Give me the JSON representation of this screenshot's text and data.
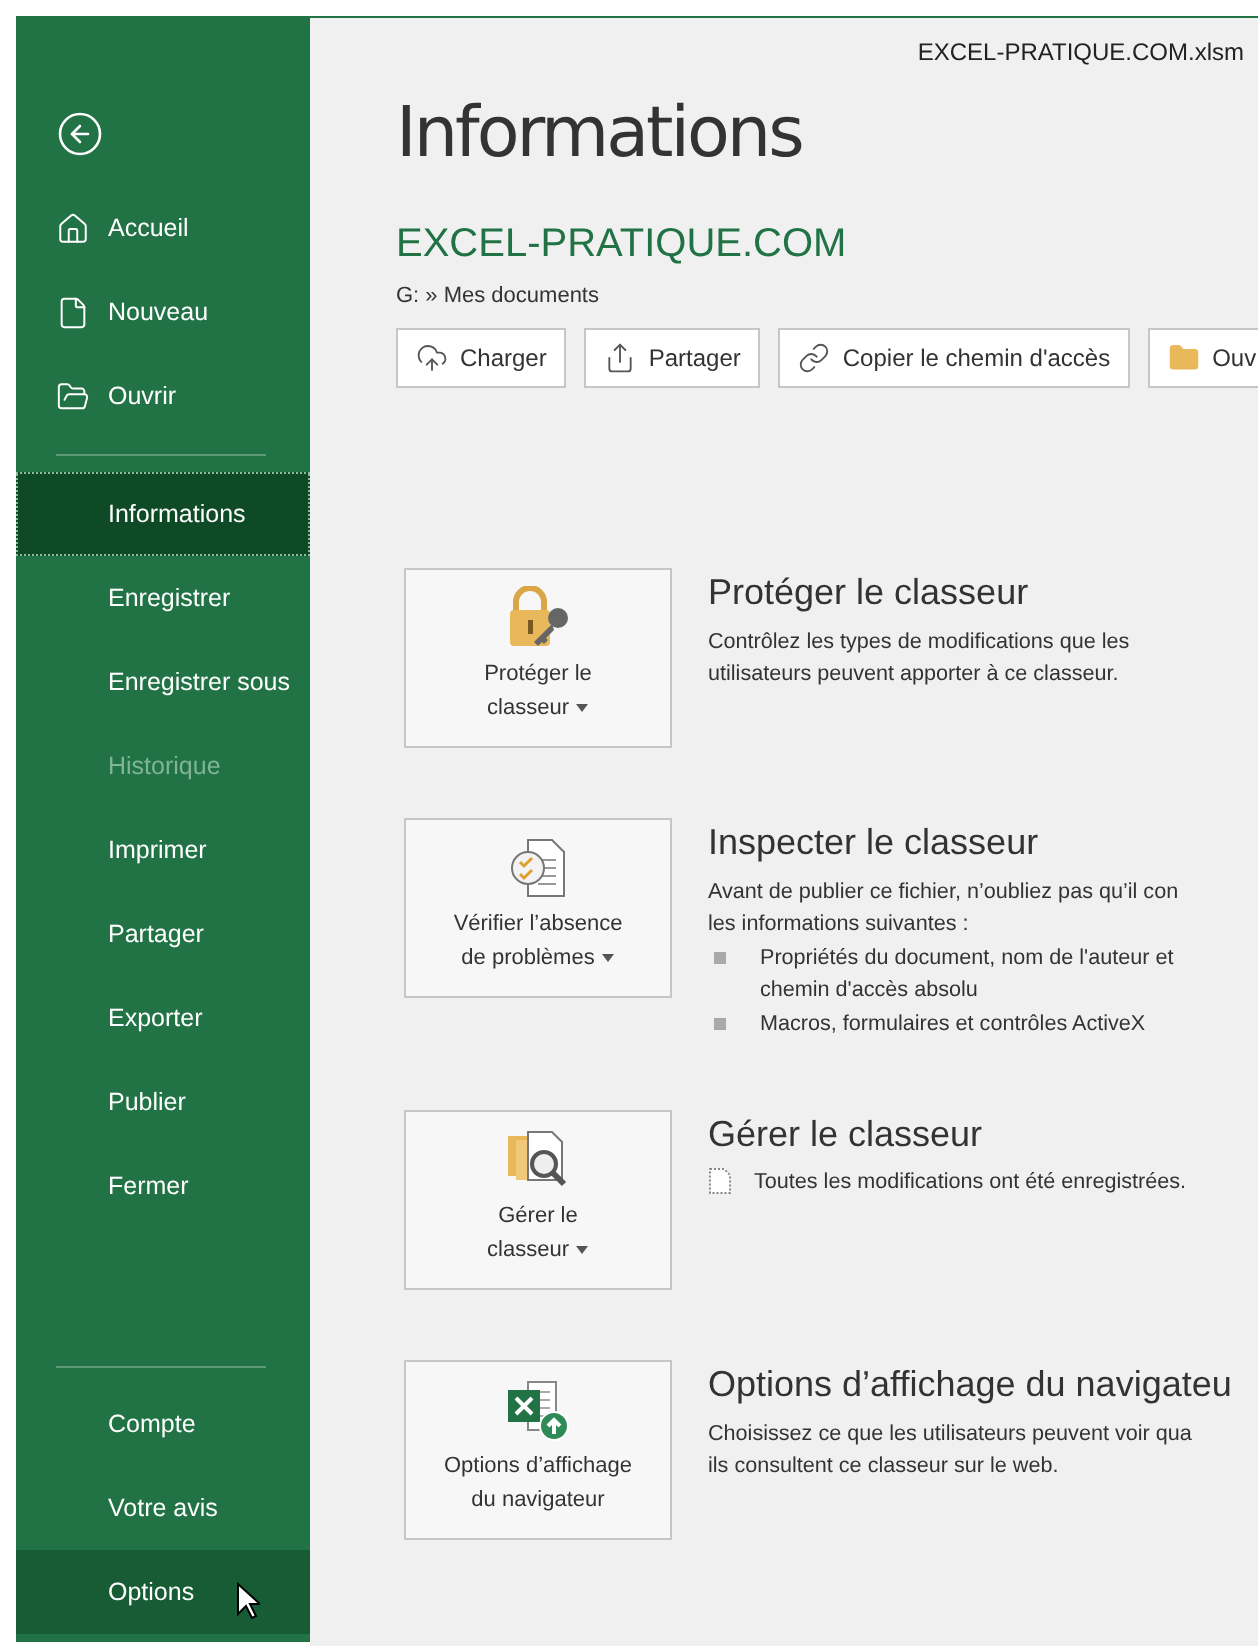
{
  "file_name": "EXCEL-PRATIQUE.COM.xlsm",
  "sidebar": {
    "top_items": [
      {
        "label": "Accueil",
        "kind": "home"
      },
      {
        "label": "Nouveau",
        "kind": "new"
      },
      {
        "label": "Ouvrir",
        "kind": "open"
      }
    ],
    "middle_items": [
      {
        "label": "Informations",
        "selected": true,
        "hovered": false,
        "disabled": false
      },
      {
        "label": "Enregistrer",
        "selected": false,
        "hovered": false,
        "disabled": false
      },
      {
        "label": "Enregistrer sous",
        "selected": false,
        "hovered": false,
        "disabled": false
      },
      {
        "label": "Historique",
        "selected": false,
        "hovered": false,
        "disabled": true
      },
      {
        "label": "Imprimer",
        "selected": false,
        "hovered": false,
        "disabled": false
      },
      {
        "label": "Partager",
        "selected": false,
        "hovered": false,
        "disabled": false
      },
      {
        "label": "Exporter",
        "selected": false,
        "hovered": false,
        "disabled": false
      },
      {
        "label": "Publier",
        "selected": false,
        "hovered": false,
        "disabled": false
      },
      {
        "label": "Fermer",
        "selected": false,
        "hovered": false,
        "disabled": false
      }
    ],
    "bottom_items": [
      {
        "label": "Compte",
        "selected": false,
        "hovered": false,
        "disabled": false
      },
      {
        "label": "Votre avis",
        "selected": false,
        "hovered": false,
        "disabled": false
      },
      {
        "label": "Options",
        "selected": false,
        "hovered": true,
        "disabled": false
      }
    ]
  },
  "page_title": "Informations",
  "workbook_name": "EXCEL-PRATIQUE.COM",
  "path": "G: » Mes documents",
  "toolbar": [
    {
      "label": "Charger",
      "kind": "upload"
    },
    {
      "label": "Partager",
      "kind": "share"
    },
    {
      "label": "Copier le chemin d'accès",
      "kind": "link"
    },
    {
      "label": "Ouv",
      "kind": "folder"
    }
  ],
  "sections": [
    {
      "kind": "protect",
      "button": "Protéger le\nclasseur",
      "dropdown": true,
      "title": "Protéger le classeur",
      "description": "Contrôlez les types de modifications que les\nutilisateurs peuvent apporter à ce classeur."
    },
    {
      "kind": "inspect",
      "button": "Vérifier l’absence\nde problèmes",
      "dropdown": true,
      "title": "Inspecter le classeur",
      "description": "Avant de publier ce fichier, n’oubliez pas qu’il con\nles informations suivantes :",
      "bullets": [
        "Propriétés du document, nom de l'auteur et\nchemin d'accès absolu",
        "Macros, formulaires et contrôles ActiveX"
      ]
    },
    {
      "kind": "manage",
      "button": "Gérer le\nclasseur",
      "dropdown": true,
      "title": "Gérer le classeur",
      "status": "Toutes les modifications ont été enregistrées."
    },
    {
      "kind": "browser",
      "button": "Options d’affichage\ndu navigateur",
      "dropdown": false,
      "title": "Options d’affichage du navigateu",
      "description": "Choisissez ce que les utilisateurs peuvent voir qua\nils consultent ce classeur sur le web."
    }
  ]
}
